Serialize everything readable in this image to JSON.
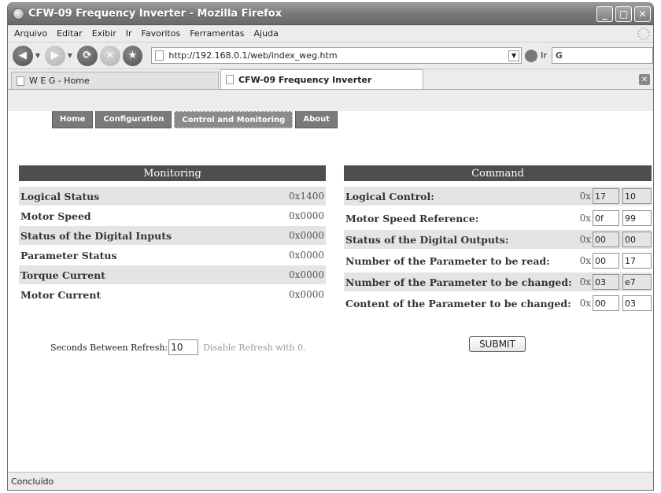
{
  "window": {
    "title": "CFW-09 Frequency Inverter - Mozilla Firefox"
  },
  "menu": [
    "Arquivo",
    "Editar",
    "Exibir",
    "Ir",
    "Favoritos",
    "Ferramentas",
    "Ajuda"
  ],
  "nav": {
    "url": "http://192.168.0.1/web/index_weg.htm",
    "go_label": "Ir",
    "search_text": "G"
  },
  "tabs": [
    {
      "label": "W E G - Home"
    },
    {
      "label": "CFW-09 Frequency Inverter"
    }
  ],
  "site_nav": [
    "Home",
    "Configuration",
    "Control and Monitoring",
    "About"
  ],
  "monitoring": {
    "title": "Monitoring",
    "rows": [
      {
        "label": "Logical Status",
        "value": "0x1400"
      },
      {
        "label": "Motor Speed",
        "value": "0x0000"
      },
      {
        "label": "Status of the Digital Inputs",
        "value": "0x0000"
      },
      {
        "label": "Parameter Status",
        "value": "0x0000"
      },
      {
        "label": "Torque Current",
        "value": "0x0000"
      },
      {
        "label": "Motor Current",
        "value": "0x0000"
      }
    ]
  },
  "command": {
    "title": "Command",
    "prefix": "0x",
    "rows": [
      {
        "label": "Logical Control:",
        "v1": "17",
        "v2": "10"
      },
      {
        "label": "Motor Speed Reference:",
        "v1": "0f",
        "v2": "99"
      },
      {
        "label": "Status of the Digital Outputs:",
        "v1": "00",
        "v2": "00"
      },
      {
        "label": "Number of the Parameter to be read:",
        "v1": "00",
        "v2": "17"
      },
      {
        "label": "Number of the Parameter to be changed:",
        "v1": "03",
        "v2": "e7"
      },
      {
        "label": "Content of the Parameter to be changed:",
        "v1": "00",
        "v2": "03"
      }
    ],
    "submit_label": "SUBMIT"
  },
  "refresh": {
    "label": "Seconds Between Refresh:",
    "value": "10",
    "hint": "Disable Refresh with 0."
  },
  "status": "Concluído"
}
